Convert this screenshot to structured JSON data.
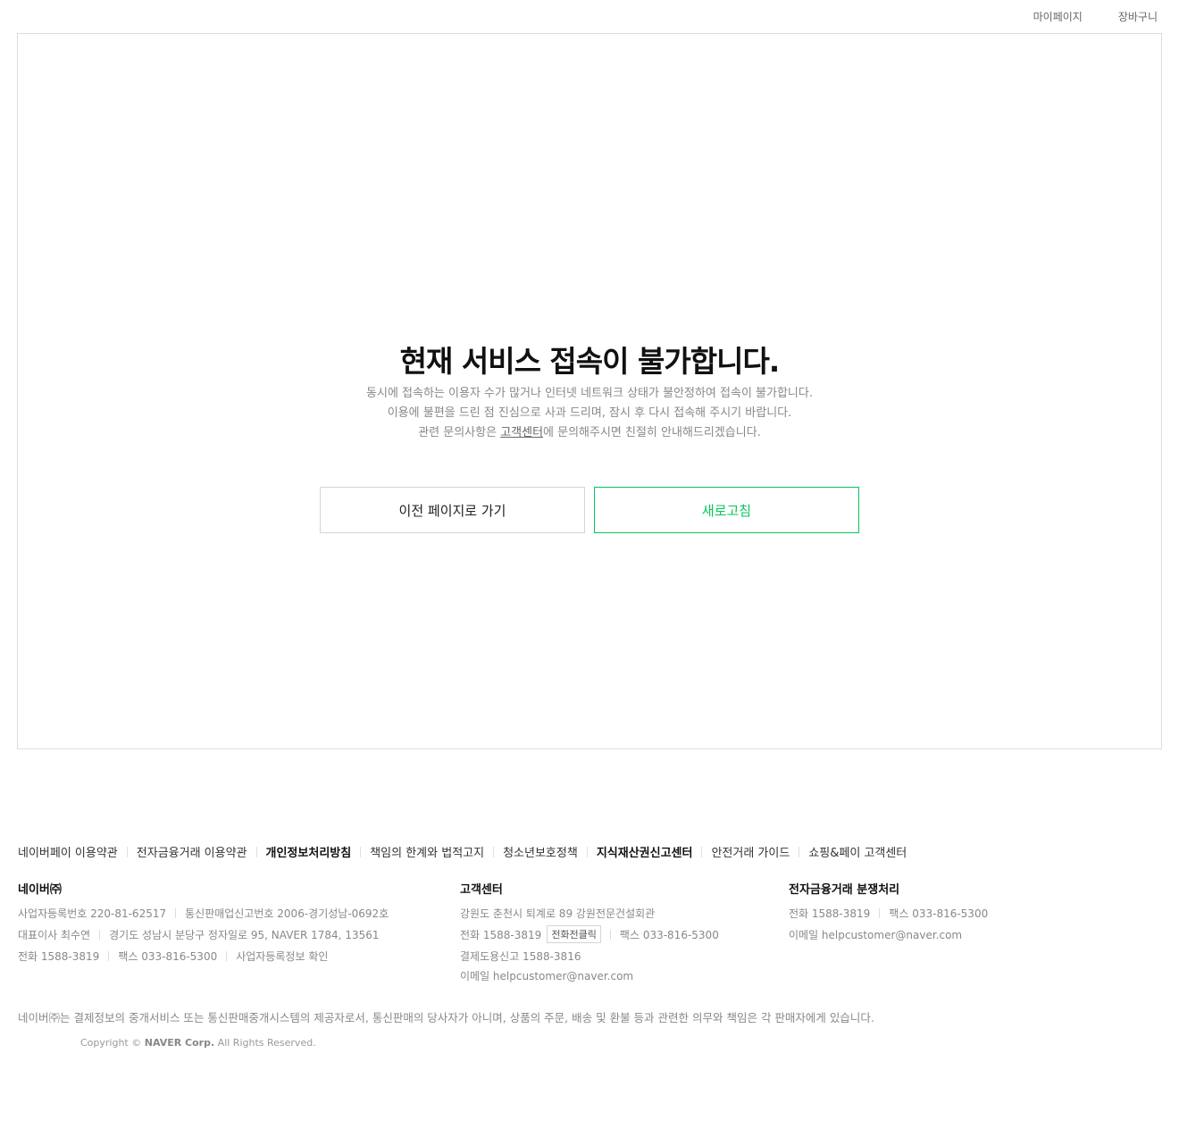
{
  "top_links": {
    "mypage": "마이페이지",
    "cart": "장바구니"
  },
  "error": {
    "title": "현재 서비스 접속이 불가합니다.",
    "line1": "동시에 접속하는 이용자 수가 많거나 인터넷 네트워크 상태가 불안정하여 접속이 불가합니다.",
    "line2": "이용에 불편을 드린 점 진심으로 사과 드리며, 잠시 후 다시 접속해 주시기 바랍니다.",
    "line3_pre": "관련 문의사항은 ",
    "line3_link": "고객센터",
    "line3_post": "에 문의해주시면 친절히 안내해드리겠습니다.",
    "back_label": "이전 페이지로 가기",
    "refresh_label": "새로고침",
    "accent_color": "#03c75a"
  },
  "footer": {
    "links": [
      {
        "label": "네이버페이 이용약관",
        "bold": false
      },
      {
        "label": "전자금융거래 이용약관",
        "bold": false
      },
      {
        "label": "개인정보처리방침",
        "bold": true
      },
      {
        "label": "책임의 한계와 법적고지",
        "bold": false
      },
      {
        "label": "청소년보호정책",
        "bold": false
      },
      {
        "label": "지식재산권신고센터",
        "bold": true
      },
      {
        "label": "안전거래 가이드",
        "bold": false
      },
      {
        "label": "쇼핑&페이 고객센터",
        "bold": false
      }
    ],
    "company": {
      "title": "네이버㈜",
      "biz_no": "사업자등록번호 220-81-62517",
      "ecommerce_no": "통신판매업신고번호 2006-경기성남-0692호",
      "ceo": "대표이사 최수연",
      "address": "경기도 성남시 분당구 정자일로 95, NAVER 1784, 13561",
      "phone": "전화 1588-3819",
      "fax": "팩스 033-816-5300",
      "biz_info_link": "사업자등록정보 확인"
    },
    "cs": {
      "title": "고객센터",
      "address": "강원도 춘천시 퇴계로 89 강원전문건설회관",
      "phone": "전화 1588-3819",
      "call_btn": "전화전클릭",
      "fax": "팩스 033-816-5300",
      "payment_report": "결제도용신고 1588-3816",
      "email": "이메일 helpcustomer@naver.com"
    },
    "dispute": {
      "title": "전자금융거래 분쟁처리",
      "phone": "전화 1588-3819",
      "fax": "팩스 033-816-5300",
      "email": "이메일 helpcustomer@naver.com"
    },
    "disclaimer": "네이버㈜는 결제정보의 중개서비스 또는 통신판매중개시스템의 제공자로서, 통신판매의 당사자가 아니며, 상품의 주문, 배송 및 환불 등과 관련한 의무와 책임은 각 판매자에게 있습니다.",
    "copyright_pre": "Copyright © ",
    "copyright_corp": "NAVER Corp.",
    "copyright_post": " All Rights Reserved."
  }
}
